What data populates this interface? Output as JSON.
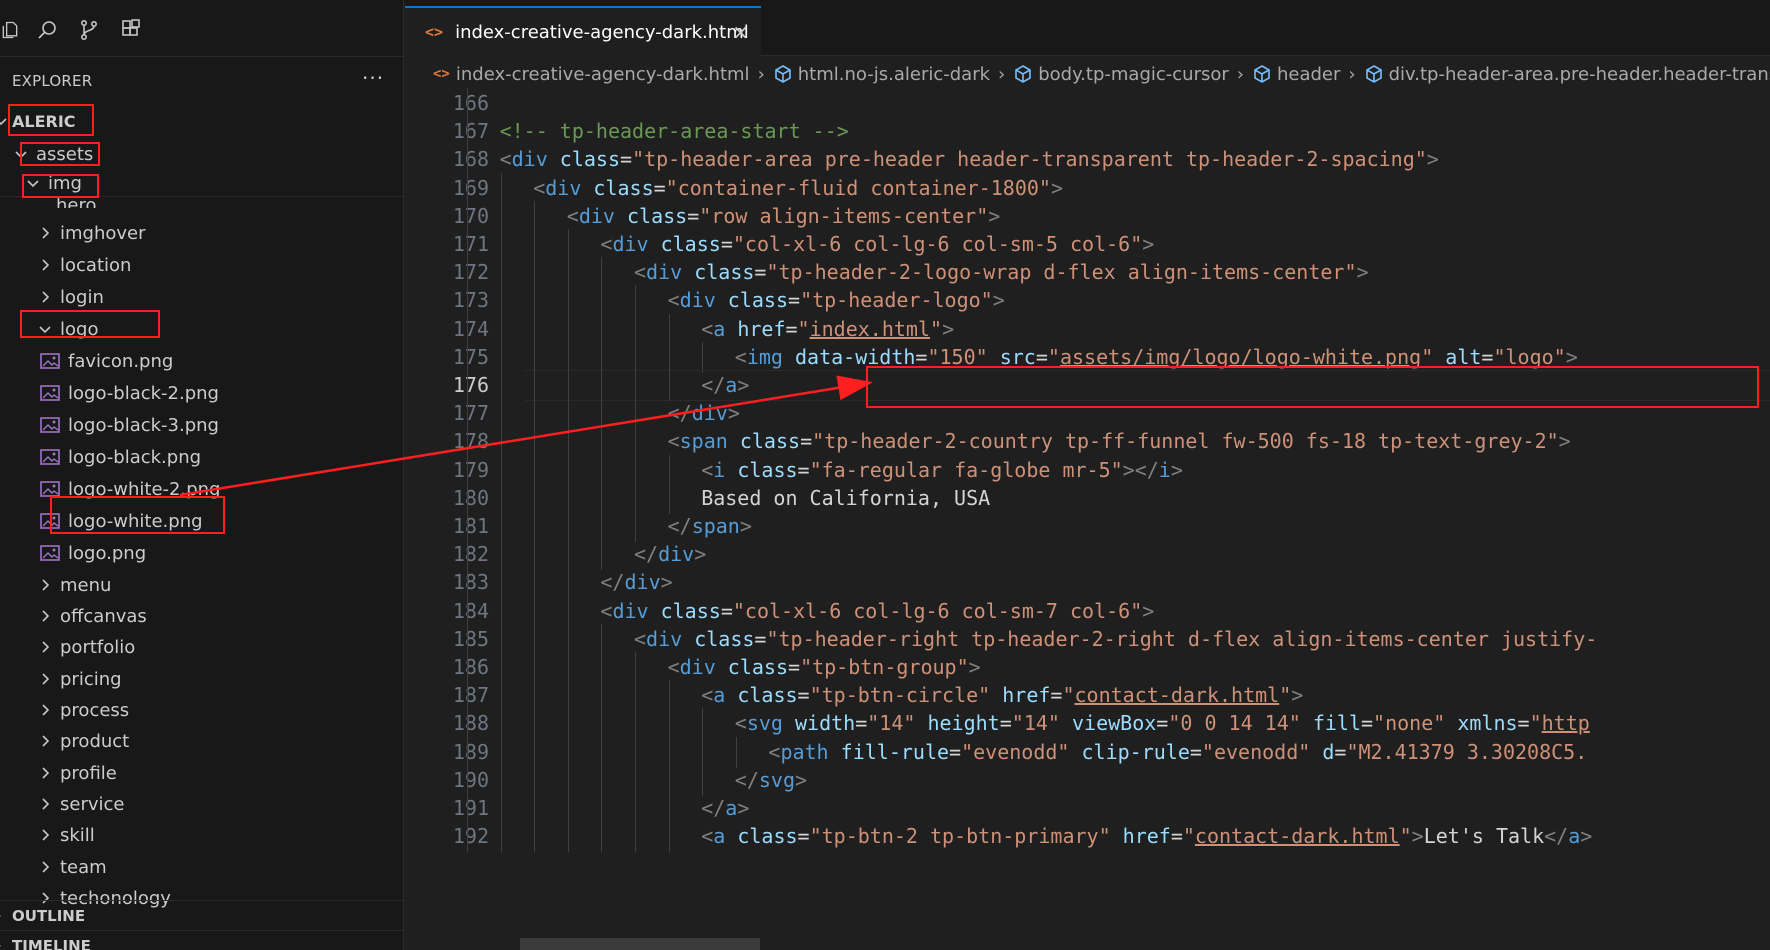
{
  "activity": {
    "icons": [
      "files-icon",
      "search-icon",
      "source-control-icon",
      "extensions-icon"
    ]
  },
  "explorer": {
    "title": "EXPLORER",
    "more": "···",
    "root": "ALERIC",
    "items": [
      {
        "label": "assets",
        "kind": "folder",
        "expanded": true
      },
      {
        "label": "img",
        "kind": "folder",
        "expanded": true
      },
      {
        "label": "hero",
        "kind": "folder",
        "expanded": false
      },
      {
        "label": "imghover",
        "kind": "folder",
        "expanded": false
      },
      {
        "label": "location",
        "kind": "folder",
        "expanded": false
      },
      {
        "label": "login",
        "kind": "folder",
        "expanded": false
      },
      {
        "label": "logo",
        "kind": "folder",
        "expanded": true
      },
      {
        "label": "favicon.png",
        "kind": "image"
      },
      {
        "label": "logo-black-2.png",
        "kind": "image"
      },
      {
        "label": "logo-black-3.png",
        "kind": "image"
      },
      {
        "label": "logo-black.png",
        "kind": "image"
      },
      {
        "label": "logo-white-2.png",
        "kind": "image"
      },
      {
        "label": "logo-white.png",
        "kind": "image"
      },
      {
        "label": "logo.png",
        "kind": "image"
      },
      {
        "label": "menu",
        "kind": "folder",
        "expanded": false
      },
      {
        "label": "offcanvas",
        "kind": "folder",
        "expanded": false
      },
      {
        "label": "portfolio",
        "kind": "folder",
        "expanded": false
      },
      {
        "label": "pricing",
        "kind": "folder",
        "expanded": false
      },
      {
        "label": "process",
        "kind": "folder",
        "expanded": false
      },
      {
        "label": "product",
        "kind": "folder",
        "expanded": false
      },
      {
        "label": "profile",
        "kind": "folder",
        "expanded": false
      },
      {
        "label": "service",
        "kind": "folder",
        "expanded": false
      },
      {
        "label": "skill",
        "kind": "folder",
        "expanded": false
      },
      {
        "label": "team",
        "kind": "folder",
        "expanded": false
      },
      {
        "label": "techonology",
        "kind": "folder",
        "expanded": false
      }
    ],
    "outline": "OUTLINE",
    "timeline": "TIMELINE"
  },
  "tab": {
    "icon": "<>",
    "label": "index-creative-agency-dark.html",
    "close": "×"
  },
  "breadcrumb": [
    {
      "label": "index-creative-agency-dark.html",
      "icon": "html-icon"
    },
    {
      "label": "html.no-js.aleric-dark",
      "icon": "cube-icon"
    },
    {
      "label": "body.tp-magic-cursor",
      "icon": "cube-icon"
    },
    {
      "label": "header",
      "icon": "cube-icon"
    },
    {
      "label": "div.tp-header-area.pre-header.header-transparent.tp",
      "icon": "cube-icon"
    }
  ],
  "editor": {
    "current_line": 176,
    "lines": [
      {
        "n": 166,
        "indent": 0,
        "tokens": []
      },
      {
        "n": 167,
        "indent": 1,
        "tokens": [
          [
            "cmt",
            "<!-- tp-header-area-start -->"
          ]
        ]
      },
      {
        "n": 168,
        "indent": 1,
        "tokens": [
          [
            "br",
            "<"
          ],
          [
            "tag",
            "div"
          ],
          [
            "attr",
            " class"
          ],
          [
            "txt",
            "="
          ],
          [
            "str",
            "\"tp-header-area pre-header header-transparent tp-header-2-spacing\""
          ],
          [
            "br",
            ">"
          ]
        ]
      },
      {
        "n": 169,
        "indent": 2,
        "tokens": [
          [
            "br",
            "<"
          ],
          [
            "tag",
            "div"
          ],
          [
            "attr",
            " class"
          ],
          [
            "txt",
            "="
          ],
          [
            "str",
            "\"container-fluid container-1800\""
          ],
          [
            "br",
            ">"
          ]
        ]
      },
      {
        "n": 170,
        "indent": 3,
        "tokens": [
          [
            "br",
            "<"
          ],
          [
            "tag",
            "div"
          ],
          [
            "attr",
            " class"
          ],
          [
            "txt",
            "="
          ],
          [
            "str",
            "\"row align-items-center\""
          ],
          [
            "br",
            ">"
          ]
        ]
      },
      {
        "n": 171,
        "indent": 4,
        "tokens": [
          [
            "br",
            "<"
          ],
          [
            "tag",
            "div"
          ],
          [
            "attr",
            " class"
          ],
          [
            "txt",
            "="
          ],
          [
            "str",
            "\"col-xl-6 col-lg-6 col-sm-5 col-6\""
          ],
          [
            "br",
            ">"
          ]
        ]
      },
      {
        "n": 172,
        "indent": 5,
        "tokens": [
          [
            "br",
            "<"
          ],
          [
            "tag",
            "div"
          ],
          [
            "attr",
            " class"
          ],
          [
            "txt",
            "="
          ],
          [
            "str",
            "\"tp-header-2-logo-wrap d-flex align-items-center\""
          ],
          [
            "br",
            ">"
          ]
        ]
      },
      {
        "n": 173,
        "indent": 6,
        "tokens": [
          [
            "br",
            "<"
          ],
          [
            "tag",
            "div"
          ],
          [
            "attr",
            " class"
          ],
          [
            "txt",
            "="
          ],
          [
            "str",
            "\"tp-header-logo\""
          ],
          [
            "br",
            ">"
          ]
        ]
      },
      {
        "n": 174,
        "indent": 7,
        "tokens": [
          [
            "br",
            "<"
          ],
          [
            "tag",
            "a"
          ],
          [
            "attr",
            " href"
          ],
          [
            "txt",
            "="
          ],
          [
            "str",
            "\""
          ],
          [
            "link",
            "index.html"
          ],
          [
            "str",
            "\""
          ],
          [
            "br",
            ">"
          ]
        ]
      },
      {
        "n": 175,
        "indent": 8,
        "tokens": [
          [
            "br",
            "<"
          ],
          [
            "tag",
            "img"
          ],
          [
            "attr",
            " data-width"
          ],
          [
            "txt",
            "="
          ],
          [
            "str",
            "\"150\""
          ],
          [
            "attr",
            " src"
          ],
          [
            "txt",
            "="
          ],
          [
            "str",
            "\""
          ],
          [
            "link",
            "assets/img/logo/logo-white.png"
          ],
          [
            "str",
            "\""
          ],
          [
            "attr",
            " alt"
          ],
          [
            "txt",
            "="
          ],
          [
            "str",
            "\"logo\""
          ],
          [
            "br",
            ">"
          ]
        ]
      },
      {
        "n": 176,
        "indent": 7,
        "tokens": [
          [
            "br",
            "</"
          ],
          [
            "tag",
            "a"
          ],
          [
            "br",
            ">"
          ]
        ]
      },
      {
        "n": 177,
        "indent": 6,
        "tokens": [
          [
            "br",
            "</"
          ],
          [
            "tag",
            "div"
          ],
          [
            "br",
            ">"
          ]
        ]
      },
      {
        "n": 178,
        "indent": 6,
        "tokens": [
          [
            "br",
            "<"
          ],
          [
            "tag",
            "span"
          ],
          [
            "attr",
            " class"
          ],
          [
            "txt",
            "="
          ],
          [
            "str",
            "\"tp-header-2-country tp-ff-funnel fw-500 fs-18 tp-text-grey-2\""
          ],
          [
            "br",
            ">"
          ]
        ]
      },
      {
        "n": 179,
        "indent": 7,
        "tokens": [
          [
            "br",
            "<"
          ],
          [
            "tag",
            "i"
          ],
          [
            "attr",
            " class"
          ],
          [
            "txt",
            "="
          ],
          [
            "str",
            "\"fa-regular fa-globe mr-5\""
          ],
          [
            "br",
            "></"
          ],
          [
            "tag",
            "i"
          ],
          [
            "br",
            ">"
          ]
        ]
      },
      {
        "n": 180,
        "indent": 7,
        "tokens": [
          [
            "txt",
            "Based on California, USA"
          ]
        ]
      },
      {
        "n": 181,
        "indent": 6,
        "tokens": [
          [
            "br",
            "</"
          ],
          [
            "tag",
            "span"
          ],
          [
            "br",
            ">"
          ]
        ]
      },
      {
        "n": 182,
        "indent": 5,
        "tokens": [
          [
            "br",
            "</"
          ],
          [
            "tag",
            "div"
          ],
          [
            "br",
            ">"
          ]
        ]
      },
      {
        "n": 183,
        "indent": 4,
        "tokens": [
          [
            "br",
            "</"
          ],
          [
            "tag",
            "div"
          ],
          [
            "br",
            ">"
          ]
        ]
      },
      {
        "n": 184,
        "indent": 4,
        "tokens": [
          [
            "br",
            "<"
          ],
          [
            "tag",
            "div"
          ],
          [
            "attr",
            " class"
          ],
          [
            "txt",
            "="
          ],
          [
            "str",
            "\"col-xl-6 col-lg-6 col-sm-7 col-6\""
          ],
          [
            "br",
            ">"
          ]
        ]
      },
      {
        "n": 185,
        "indent": 5,
        "tokens": [
          [
            "br",
            "<"
          ],
          [
            "tag",
            "div"
          ],
          [
            "attr",
            " class"
          ],
          [
            "txt",
            "="
          ],
          [
            "str",
            "\"tp-header-right tp-header-2-right d-flex align-items-center justify-"
          ]
        ]
      },
      {
        "n": 186,
        "indent": 6,
        "tokens": [
          [
            "br",
            "<"
          ],
          [
            "tag",
            "div"
          ],
          [
            "attr",
            " class"
          ],
          [
            "txt",
            "="
          ],
          [
            "str",
            "\"tp-btn-group\""
          ],
          [
            "br",
            ">"
          ]
        ]
      },
      {
        "n": 187,
        "indent": 7,
        "tokens": [
          [
            "br",
            "<"
          ],
          [
            "tag",
            "a"
          ],
          [
            "attr",
            " class"
          ],
          [
            "txt",
            "="
          ],
          [
            "str",
            "\"tp-btn-circle\""
          ],
          [
            "attr",
            " href"
          ],
          [
            "txt",
            "="
          ],
          [
            "str",
            "\""
          ],
          [
            "link",
            "contact-dark.html"
          ],
          [
            "str",
            "\""
          ],
          [
            "br",
            ">"
          ]
        ]
      },
      {
        "n": 188,
        "indent": 8,
        "tokens": [
          [
            "br",
            "<"
          ],
          [
            "tag",
            "svg"
          ],
          [
            "attr",
            " width"
          ],
          [
            "txt",
            "="
          ],
          [
            "str",
            "\"14\""
          ],
          [
            "attr",
            " height"
          ],
          [
            "txt",
            "="
          ],
          [
            "str",
            "\"14\""
          ],
          [
            "attr",
            " viewBox"
          ],
          [
            "txt",
            "="
          ],
          [
            "str",
            "\"0 0 14 14\""
          ],
          [
            "attr",
            " fill"
          ],
          [
            "txt",
            "="
          ],
          [
            "str",
            "\"none\""
          ],
          [
            "attr",
            " xmlns"
          ],
          [
            "txt",
            "="
          ],
          [
            "str",
            "\""
          ],
          [
            "link",
            "http"
          ]
        ]
      },
      {
        "n": 189,
        "indent": 9,
        "tokens": [
          [
            "br",
            "<"
          ],
          [
            "tag",
            "path"
          ],
          [
            "attr",
            " fill-rule"
          ],
          [
            "txt",
            "="
          ],
          [
            "str",
            "\"evenodd\""
          ],
          [
            "attr",
            " clip-rule"
          ],
          [
            "txt",
            "="
          ],
          [
            "str",
            "\"evenodd\""
          ],
          [
            "attr",
            " d"
          ],
          [
            "txt",
            "="
          ],
          [
            "str",
            "\"M2.41379 3.30208C5."
          ]
        ]
      },
      {
        "n": 190,
        "indent": 8,
        "tokens": [
          [
            "br",
            "</"
          ],
          [
            "tag",
            "svg"
          ],
          [
            "br",
            ">"
          ]
        ]
      },
      {
        "n": 191,
        "indent": 7,
        "tokens": [
          [
            "br",
            "</"
          ],
          [
            "tag",
            "a"
          ],
          [
            "br",
            ">"
          ]
        ]
      },
      {
        "n": 192,
        "indent": 7,
        "tokens": [
          [
            "br",
            "<"
          ],
          [
            "tag",
            "a"
          ],
          [
            "attr",
            " class"
          ],
          [
            "txt",
            "="
          ],
          [
            "str",
            "\"tp-btn-2 tp-btn-primary\""
          ],
          [
            "attr",
            " href"
          ],
          [
            "txt",
            "="
          ],
          [
            "str",
            "\""
          ],
          [
            "link",
            "contact-dark.html"
          ],
          [
            "str",
            "\""
          ],
          [
            "br",
            ">"
          ],
          [
            "txt",
            "Let's Talk"
          ],
          [
            "br",
            "</"
          ],
          [
            "tag",
            "a"
          ],
          [
            "br",
            ">"
          ]
        ]
      }
    ]
  }
}
